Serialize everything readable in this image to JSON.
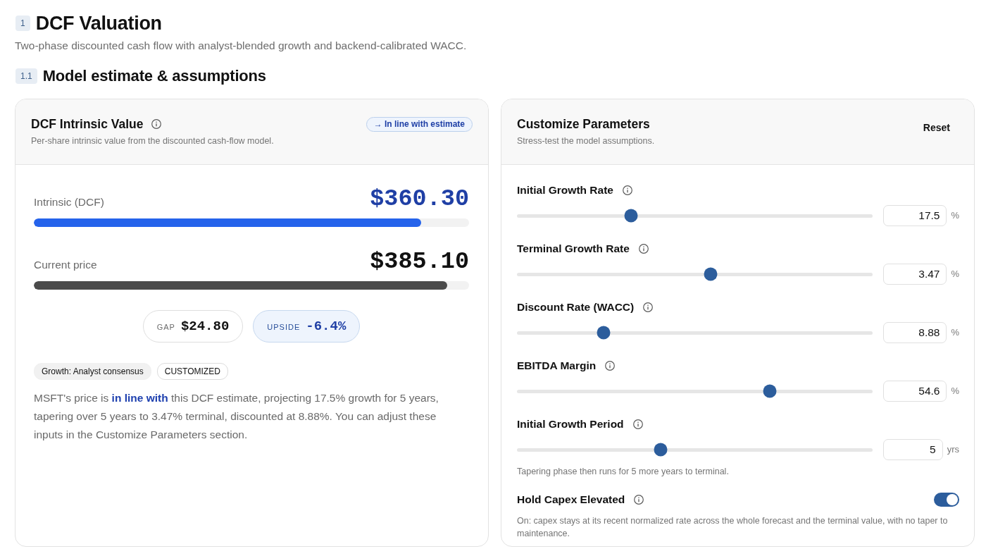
{
  "section": {
    "number": "1",
    "title": "DCF Valuation",
    "subtitle": "Two-phase discounted cash flow with analyst-blended growth and backend-calibrated WACC."
  },
  "subsection": {
    "number": "1.1",
    "title": "Model estimate & assumptions"
  },
  "valuation_card": {
    "title": "DCF Intrinsic Value",
    "subtitle": "Per-share intrinsic value from the discounted cash-flow model.",
    "verdict": "→ In line with estimate",
    "bars": [
      {
        "kind": "intrinsic",
        "label": "Intrinsic (DCF)",
        "value": "$360.30",
        "level": 0.89
      },
      {
        "kind": "price",
        "label": "Current price",
        "value": "$385.10",
        "level": 0.95
      }
    ],
    "stats": [
      {
        "kind": "neutral",
        "label": "GAP",
        "value": "$24.80"
      },
      {
        "kind": "accent",
        "label": "UPSIDE",
        "value": "-6.4%"
      }
    ],
    "tags": [
      {
        "kind": "filled",
        "label": "Growth: Analyst consensus"
      },
      {
        "kind": "outline",
        "label": "CUSTOMIZED"
      }
    ],
    "summary": "MSFT's price is **in line with** this DCF estimate, projecting 17.5% growth for 5 years, tapering over 5 years to 3.47% terminal, discounted at 8.88%. You can adjust these inputs in the Customize Parameters section."
  },
  "parameters_card": {
    "title": "Customize Parameters",
    "subtitle": "Stress-test the model assumptions.",
    "reset_button": "Reset",
    "parameters": [
      {
        "kind": "slider",
        "label": "Initial Growth Rate",
        "level": 0.32,
        "value": "17.5",
        "unit": "%"
      },
      {
        "kind": "slider",
        "label": "Terminal Growth Rate",
        "level": 0.545,
        "value": "3.47",
        "unit": "%"
      },
      {
        "kind": "slider",
        "label": "Discount Rate (WACC)",
        "level": 0.243,
        "value": "8.88",
        "unit": "%"
      },
      {
        "kind": "slider",
        "label": "EBITDA Margin",
        "level": 0.71,
        "value": "54.6",
        "unit": "%"
      },
      {
        "kind": "slider",
        "label": "Initial Growth Period",
        "level": 0.403,
        "value": "5",
        "unit": "yrs",
        "note": "Tapering phase then runs for 5 more years to terminal."
      },
      {
        "kind": "toggle",
        "label": "Hold Capex Elevated",
        "on": true,
        "note": "On: capex stays at its recent normalized rate across the whole forecast and the terminal value, with no taper to maintenance."
      }
    ]
  }
}
